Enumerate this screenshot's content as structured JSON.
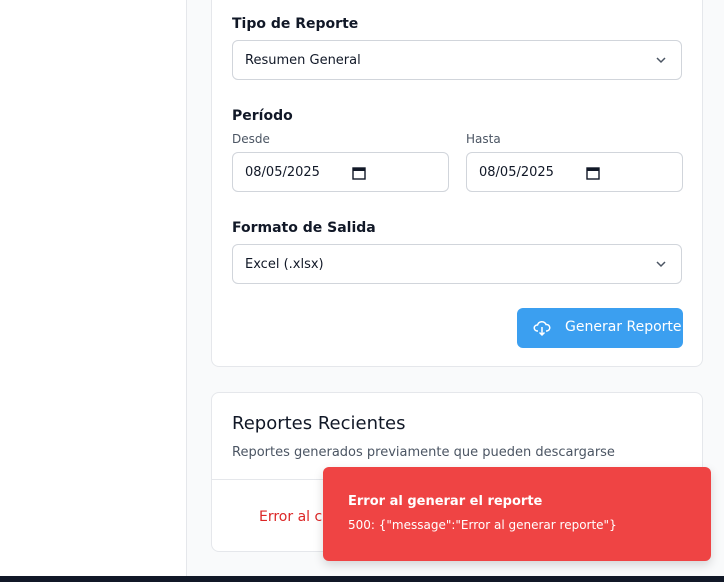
{
  "form": {
    "report_type": {
      "label": "Tipo de Reporte",
      "value": "Resumen General"
    },
    "period": {
      "label": "Período",
      "from_label": "Desde",
      "from_value": "08/05/2025",
      "to_label": "Hasta",
      "to_value": "08/05/2025"
    },
    "output_format": {
      "label": "Formato de Salida",
      "value": "Excel (.xlsx)"
    },
    "generate_button": "Generar Reporte"
  },
  "recent": {
    "title": "Reportes Recientes",
    "subtitle": "Reportes generados previamente que pueden descargarse",
    "error_text": "Error al cargar"
  },
  "toast": {
    "title": "Error al generar el reporte",
    "message": "500: {\"message\":\"Error al generar reporte\"}"
  },
  "colors": {
    "primary": "#3b9ff0",
    "error": "#ef4444",
    "error_text": "#dc2626"
  }
}
